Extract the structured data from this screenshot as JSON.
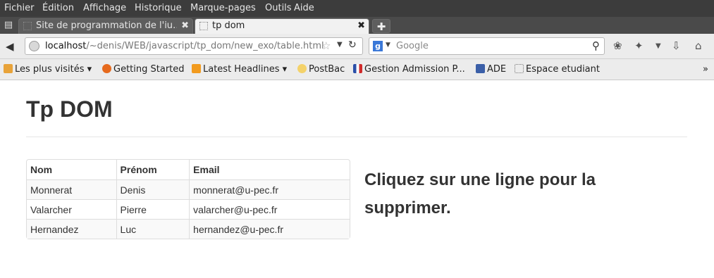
{
  "menu": [
    "Fichier",
    "Édition",
    "Affichage",
    "Historique",
    "Marque-pages",
    "Outils",
    "Aide"
  ],
  "tabs": [
    {
      "title": "Site de programmation de l'iu…",
      "active": false
    },
    {
      "title": "tp dom",
      "active": true
    }
  ],
  "nav": {
    "url_host": "localhost",
    "url_path": "/~denis/WEB/javascript/tp_dom/new_exo/table.html",
    "search_engine": "Google",
    "search_placeholder": "Google"
  },
  "bookmarks": [
    {
      "label": "Les plus visités ▾",
      "icon": "most-visited-icon"
    },
    {
      "label": "Getting Started",
      "icon": "firefox-icon"
    },
    {
      "label": "Latest Headlines ▾",
      "icon": "rss-icon"
    },
    {
      "label": "PostBac",
      "icon": "postbac-icon"
    },
    {
      "label": "Gestion Admission P...",
      "icon": "flag-icon"
    },
    {
      "label": "ADE",
      "icon": "ade-icon"
    },
    {
      "label": "Espace etudiant",
      "icon": "page-icon"
    }
  ],
  "page": {
    "title": "Tp DOM",
    "instruction": "Cliquez sur une ligne pour la supprimer.",
    "table": {
      "headers": [
        "Nom",
        "Prénom",
        "Email"
      ],
      "rows": [
        [
          "Monnerat",
          "Denis",
          "monnerat@u-pec.fr"
        ],
        [
          "Valarcher",
          "Pierre",
          "valarcher@u-pec.fr"
        ],
        [
          "Hernandez",
          "Luc",
          "hernandez@u-pec.fr"
        ]
      ]
    }
  },
  "colors": {
    "menubar": "#3c3c3c",
    "toolbar": "#ececec",
    "text": "#333333",
    "stripe": "#f9f9f9"
  }
}
